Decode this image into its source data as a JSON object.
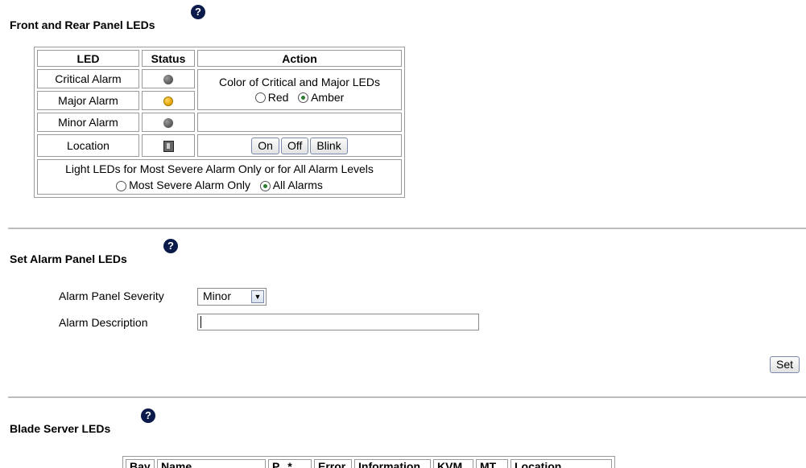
{
  "front_rear": {
    "title": "Front and Rear Panel LEDs",
    "headers": {
      "led": "LED",
      "status": "Status",
      "action": "Action"
    },
    "rows": [
      {
        "led": "Critical Alarm",
        "status_color": "gray"
      },
      {
        "led": "Major Alarm",
        "status_color": "amber"
      },
      {
        "led": "Minor Alarm",
        "status_color": "gray"
      },
      {
        "led": "Location",
        "status_icon": "location-led-icon"
      }
    ],
    "color_action": {
      "label": "Color of Critical and Major LEDs",
      "options": [
        "Red",
        "Amber"
      ],
      "selected": "Amber"
    },
    "location_buttons": [
      "On",
      "Off",
      "Blink"
    ],
    "light_mode": {
      "label": "Light LEDs for Most Severe Alarm Only or for All Alarm Levels",
      "options": [
        "Most Severe Alarm Only",
        "All Alarms"
      ],
      "selected": "All Alarms"
    }
  },
  "alarm_panel": {
    "title": "Set Alarm Panel LEDs",
    "severity_label": "Alarm Panel Severity",
    "severity_value": "Minor",
    "description_label": "Alarm Description",
    "description_value": "",
    "set_button": "Set"
  },
  "blade": {
    "title": "Blade Server LEDs",
    "columns": [
      "Bay",
      "Name",
      "P...*",
      "Error",
      "Information",
      "KVM",
      "MT",
      "Location"
    ]
  },
  "help_icon_glyph": "?",
  "colors": {
    "amber": "#e3a000",
    "help_icon": "#0a1a4a",
    "divider": "#bdbdbd"
  }
}
